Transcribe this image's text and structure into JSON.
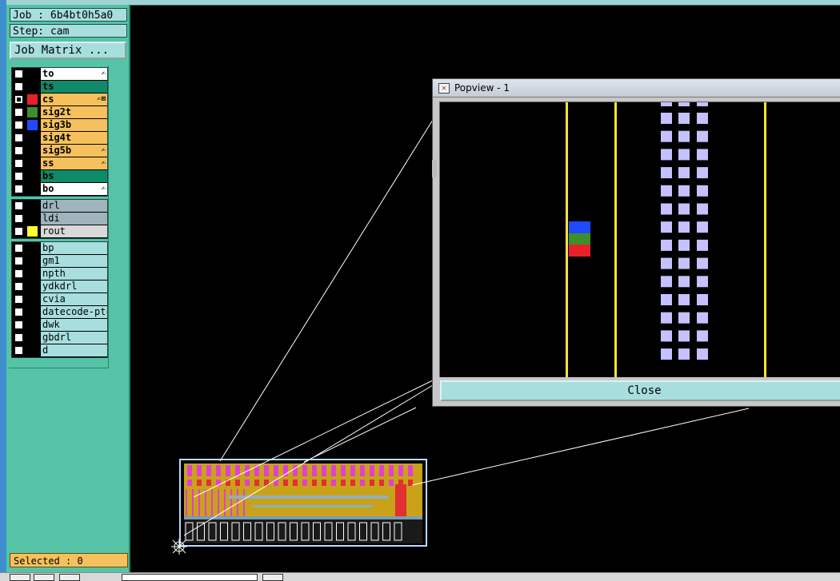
{
  "job_label": "Job : 6b4bt0h5a0",
  "step_label": "Step: cam",
  "job_matrix_label": "Job Matrix ...",
  "layers": {
    "board": [
      {
        "name": "to",
        "color": "#ffffff",
        "swatch": "",
        "checked": false,
        "icon": "✍"
      },
      {
        "name": "ts",
        "color": "#0e8a6a",
        "swatch": "",
        "checked": false,
        "icon": ""
      },
      {
        "name": "cs",
        "color": "#f6c15d",
        "swatch": "#e8202a",
        "checked": true,
        "icon": "✍⊠"
      },
      {
        "name": "sig2t",
        "color": "#f6c15d",
        "swatch": "#3c8f2a",
        "checked": false,
        "icon": ""
      },
      {
        "name": "sig3b",
        "color": "#f6c15d",
        "swatch": "#1e4bff",
        "checked": false,
        "icon": ""
      },
      {
        "name": "sig4t",
        "color": "#f6c15d",
        "swatch": "",
        "checked": false,
        "icon": ""
      },
      {
        "name": "sig5b",
        "color": "#f6c15d",
        "swatch": "",
        "checked": false,
        "icon": "✍"
      },
      {
        "name": "ss",
        "color": "#f6c15d",
        "swatch": "",
        "checked": false,
        "icon": "✍"
      },
      {
        "name": "bs",
        "color": "#0e8a6a",
        "swatch": "",
        "checked": false,
        "icon": ""
      },
      {
        "name": "bo",
        "color": "#ffffff",
        "swatch": "",
        "checked": false,
        "icon": "✍"
      }
    ],
    "drill": [
      {
        "name": "drl",
        "color": "#9fb4bc",
        "swatch": "",
        "checked": false,
        "icon": ""
      },
      {
        "name": "ldi",
        "color": "#9fb4bc",
        "swatch": "",
        "checked": false,
        "icon": ""
      },
      {
        "name": "rout",
        "color": "#d9d9d9",
        "swatch": "#ffff33",
        "checked": false,
        "icon": ""
      }
    ],
    "misc": [
      {
        "name": "bp",
        "color": "#a8dede",
        "swatch": "",
        "checked": false,
        "icon": ""
      },
      {
        "name": "gm1",
        "color": "#a8dede",
        "swatch": "",
        "checked": false,
        "icon": ""
      },
      {
        "name": "npth",
        "color": "#a8dede",
        "swatch": "",
        "checked": false,
        "icon": ""
      },
      {
        "name": "ydkdrl",
        "color": "#a8dede",
        "swatch": "",
        "checked": false,
        "icon": ""
      },
      {
        "name": "cvia",
        "color": "#a8dede",
        "swatch": "",
        "checked": false,
        "icon": ""
      },
      {
        "name": "datecode-ptc",
        "color": "#a8dede",
        "swatch": "",
        "checked": false,
        "icon": ""
      },
      {
        "name": "dwk",
        "color": "#a8dede",
        "swatch": "",
        "checked": false,
        "icon": ""
      },
      {
        "name": "gbdrl",
        "color": "#a8dede",
        "swatch": "",
        "checked": false,
        "icon": ""
      },
      {
        "name": "d",
        "color": "#a8dede",
        "swatch": "",
        "checked": false,
        "icon": ""
      }
    ]
  },
  "selected_label": "Selected : 0",
  "popview": {
    "title": "Popview - 1",
    "close_label": "Close"
  },
  "colors": {
    "panel_bg": "#55c4a6",
    "field_bg": "#a8dede",
    "popview_pad": "#c5c1ff",
    "yellow_trace": "#ffe23a",
    "board_copper": "#c9a21a",
    "board_magenta": "#e040d0"
  }
}
